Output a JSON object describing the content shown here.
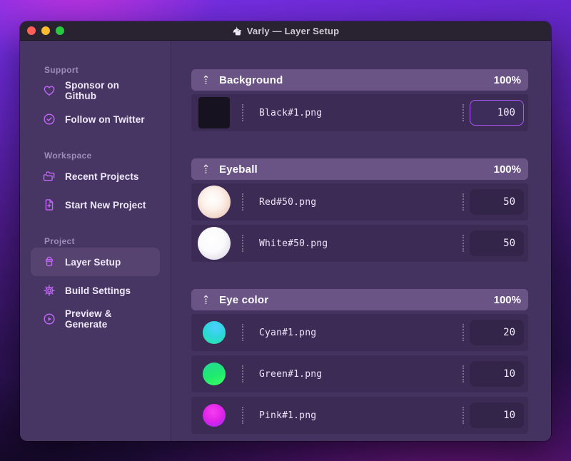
{
  "window": {
    "title": "Varly — Layer Setup",
    "app_icon": "unicorn-icon"
  },
  "colors": {
    "accent_purple": "#c266f7",
    "focus_border": "#ac58f6",
    "group_header_bg": "#6a5486",
    "row_bg": "#3b2b55",
    "sidebar_bg": "#473663",
    "titlebar_bg": "#292331",
    "traffic_red": "#ff5f57",
    "traffic_yellow": "#febc2e",
    "traffic_green": "#28c840"
  },
  "sidebar": {
    "sections": [
      {
        "label": "Support",
        "items": [
          {
            "label": "Sponsor on Github",
            "icon": "heart-icon"
          },
          {
            "label": "Follow on Twitter",
            "icon": "badge-check-icon"
          }
        ]
      },
      {
        "label": "Workspace",
        "items": [
          {
            "label": "Recent Projects",
            "icon": "folder-icon"
          },
          {
            "label": "Start New Project",
            "icon": "file-plus-icon"
          }
        ]
      },
      {
        "label": "Project",
        "items": [
          {
            "label": "Layer Setup",
            "icon": "archive-icon",
            "active": true
          },
          {
            "label": "Build Settings",
            "icon": "gear-icon"
          },
          {
            "label": "Preview & Generate",
            "icon": "play-circle-icon"
          }
        ]
      }
    ]
  },
  "layers": {
    "groups": [
      {
        "name": "Background",
        "weight": "100%",
        "rows": [
          {
            "file": "Black#1.png",
            "value": "100",
            "thumb": "black-square",
            "focused": true
          }
        ]
      },
      {
        "name": "Eyeball",
        "weight": "100%",
        "rows": [
          {
            "file": "Red#50.png",
            "value": "50",
            "thumb": "red-sphere"
          },
          {
            "file": "White#50.png",
            "value": "50",
            "thumb": "white-sphere"
          }
        ]
      },
      {
        "name": "Eye color",
        "weight": "100%",
        "rows": [
          {
            "file": "Cyan#1.png",
            "value": "20",
            "thumb": "cyan-sphere"
          },
          {
            "file": "Green#1.png",
            "value": "10",
            "thumb": "green-sphere"
          },
          {
            "file": "Pink#1.png",
            "value": "10",
            "thumb": "pink-sphere"
          }
        ]
      }
    ]
  }
}
